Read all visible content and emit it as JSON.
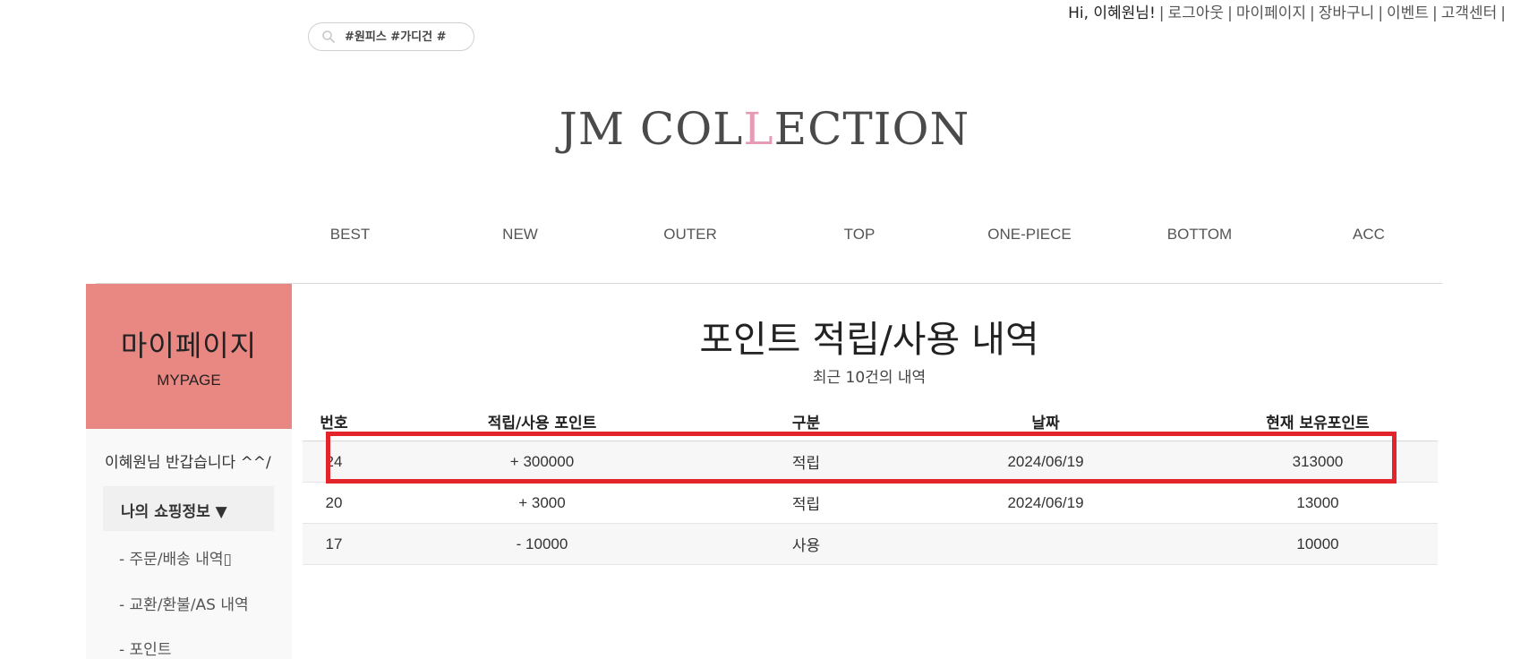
{
  "search": {
    "placeholder": "#원피스 #가디건 #"
  },
  "top_links": {
    "greeting": "Hi, 이혜원님!",
    "items": [
      "로그아웃",
      "마이페이지",
      "장바구니",
      "이벤트",
      "고객센터"
    ]
  },
  "logo": {
    "part1": "JM COL",
    "part2": "L",
    "part3": "ECTION"
  },
  "nav": [
    "BEST",
    "NEW",
    "OUTER",
    "TOP",
    "ONE-PIECE",
    "BOTTOM",
    "ACC"
  ],
  "sidebar": {
    "title": "마이페이지",
    "subtitle": "MYPAGE",
    "welcome": "이혜원님 반갑습니다 ^^/",
    "section": "나의 쇼핑정보 ▼",
    "links": [
      "- 주문/배송 내역▯",
      "- 교환/환불/AS 내역",
      "- 포인트"
    ]
  },
  "main": {
    "title": "포인트 적립/사용 내역",
    "subtitle": "최근 10건의 내역",
    "columns": [
      "번호",
      "적립/사용 포인트",
      "구분",
      "날짜",
      "현재 보유포인트"
    ],
    "rows": [
      [
        "24",
        "+ 300000",
        "적립",
        "2024/06/19",
        "313000"
      ],
      [
        "20",
        "+ 3000",
        "적립",
        "2024/06/19",
        "13000"
      ],
      [
        "17",
        "- 10000",
        "사용",
        "",
        "10000"
      ]
    ]
  },
  "colors": {
    "sidebar_header": "#e98883",
    "logo_accent": "#e59ab5",
    "highlight": "#e3242b"
  }
}
